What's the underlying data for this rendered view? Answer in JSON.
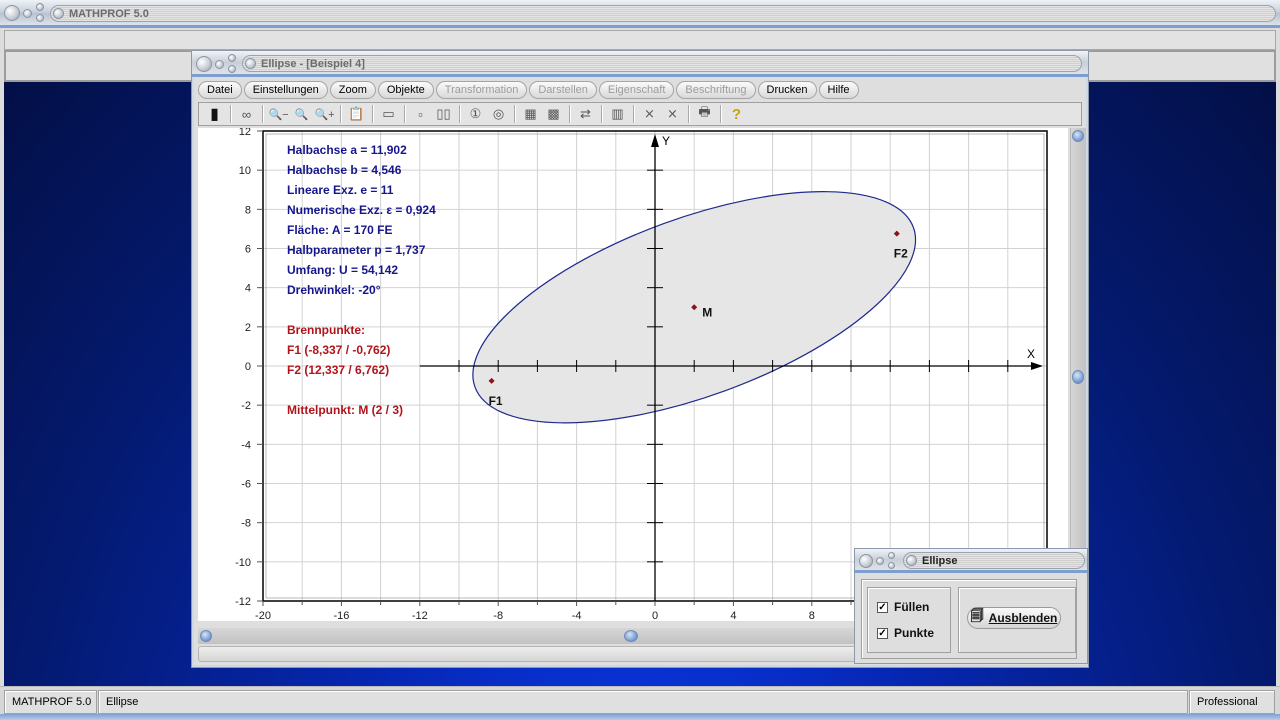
{
  "app": {
    "title": "MATHPROF 5.0"
  },
  "window": {
    "title": "Ellipse - [Beispiel 4]",
    "menu": [
      {
        "label": "Datei",
        "enabled": true
      },
      {
        "label": "Einstellungen",
        "enabled": true
      },
      {
        "label": "Zoom",
        "enabled": true
      },
      {
        "label": "Objekte",
        "enabled": true
      },
      {
        "label": "Transformation",
        "enabled": false
      },
      {
        "label": "Darstellen",
        "enabled": false
      },
      {
        "label": "Eigenschaft",
        "enabled": false
      },
      {
        "label": "Beschriftung",
        "enabled": false
      },
      {
        "label": "Drucken",
        "enabled": true
      },
      {
        "label": "Hilfe",
        "enabled": true
      }
    ],
    "toolbar": [
      {
        "name": "screen-icon",
        "glyph": "▮"
      },
      {
        "sep": true
      },
      {
        "name": "glasses-icon",
        "glyph": "∞"
      },
      {
        "sep": true
      },
      {
        "name": "zoom-out-icon",
        "glyph": "🔍−"
      },
      {
        "name": "zoom-reset-icon",
        "glyph": "🔍"
      },
      {
        "name": "zoom-in-icon",
        "glyph": "🔍+"
      },
      {
        "sep": true
      },
      {
        "name": "clipboard-icon",
        "glyph": "📋"
      },
      {
        "sep": true
      },
      {
        "name": "window-icon",
        "glyph": "▭"
      },
      {
        "sep": true
      },
      {
        "name": "box-small-icon",
        "glyph": "▫"
      },
      {
        "name": "box-double-icon",
        "glyph": "▯▯"
      },
      {
        "sep": true
      },
      {
        "name": "circle-1-icon",
        "glyph": "①"
      },
      {
        "name": "circle-at-icon",
        "glyph": "◎"
      },
      {
        "sep": true
      },
      {
        "name": "table-icon",
        "glyph": "▦"
      },
      {
        "name": "image-icon",
        "glyph": "▩"
      },
      {
        "sep": true
      },
      {
        "name": "export-icon",
        "glyph": "⇄"
      },
      {
        "sep": true
      },
      {
        "name": "pages-icon",
        "glyph": "▥"
      },
      {
        "sep": true
      },
      {
        "name": "cross-small-icon",
        "glyph": "⨯"
      },
      {
        "name": "cross-large-icon",
        "glyph": "⨯"
      },
      {
        "sep": true
      },
      {
        "name": "printer-icon",
        "glyph": "🖶"
      },
      {
        "sep": true
      },
      {
        "name": "help-icon",
        "glyph": "?"
      }
    ]
  },
  "info": {
    "blue_lines": [
      "Halbachse a = 11,902",
      "Halbachse b = 4,546",
      "Lineare Exz. e = 11",
      "Numerische Exz.  ε = 0,924",
      "Fläche: A = 170 FE",
      "Halbparameter p = 1,737",
      "Umfang: U = 54,142",
      "Drehwinkel: -20°"
    ],
    "red_lines": [
      "Brennpunkte:",
      "F1 (-8,337 / -0,762)",
      "F2 (12,337 / 6,762)",
      "Mittelpunkt: M (2 / 3)"
    ]
  },
  "chart_data": {
    "type": "scatter",
    "title": "",
    "xlabel": "X",
    "ylabel": "Y",
    "xlim": [
      -20,
      20
    ],
    "ylim": [
      -12,
      12
    ],
    "grid": true,
    "x_ticks": [
      -20,
      -16,
      -12,
      -8,
      -4,
      0,
      4,
      8
    ],
    "y_ticks": [
      12,
      10,
      8,
      6,
      4,
      2,
      0,
      -2,
      -4,
      -6,
      -8,
      -10,
      -12
    ],
    "ellipse": {
      "center": [
        2,
        3
      ],
      "semi_major": 11.902,
      "semi_minor": 4.546,
      "rotation_deg": 20,
      "fill": "#e6e6e6",
      "stroke": "#1e2a8c"
    },
    "points": [
      {
        "label": "F1",
        "x": -8.337,
        "y": -0.762
      },
      {
        "label": "F2",
        "x": 12.337,
        "y": 6.762
      },
      {
        "label": "M",
        "x": 2,
        "y": 3
      }
    ],
    "point_color": "#8b1414"
  },
  "dialog": {
    "title": "Ellipse",
    "fill_label": "Füllen",
    "fill_checked": true,
    "points_label": "Punkte",
    "points_checked": true,
    "hide_button": "Ausblenden"
  },
  "statusbar": {
    "app": "MATHPROF 5.0",
    "module": "Ellipse",
    "edition": "Professional"
  }
}
